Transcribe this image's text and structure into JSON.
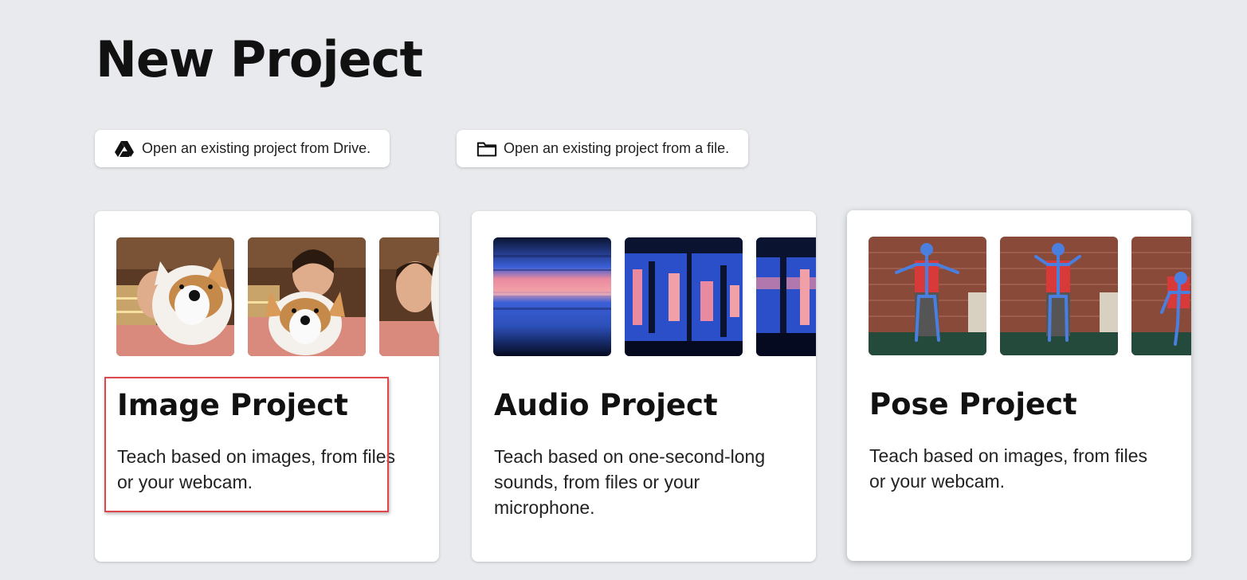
{
  "page": {
    "title": "New Project"
  },
  "open_buttons": {
    "drive": {
      "label": "Open an existing project from Drive.",
      "icon": "google-drive-icon"
    },
    "file": {
      "label": "Open an existing project from a file.",
      "icon": "folder-icon"
    }
  },
  "projects": [
    {
      "title": "Image Project",
      "description": "Teach based on images, from files or your webcam.",
      "thumbnails": [
        "webcam-photo-plush-corgi-1",
        "webcam-photo-plush-corgi-2",
        "webcam-photo-plush-corgi-3"
      ]
    },
    {
      "title": "Audio Project",
      "description": "Teach based on one-second-long sounds, from files or your microphone.",
      "thumbnails": [
        "spectrogram-1",
        "spectrogram-2",
        "spectrogram-3"
      ]
    },
    {
      "title": "Pose Project",
      "description": "Teach based on images, from files or your webcam.",
      "thumbnails": [
        "pose-skeleton-1",
        "pose-skeleton-2",
        "pose-skeleton-3"
      ]
    }
  ],
  "colors": {
    "background": "#e8eaed",
    "card": "#ffffff",
    "highlight_border": "#e0474c",
    "pose_skeleton": "#4a7fe0",
    "spectrogram_base": "#2c5bd6",
    "spectrogram_hot": "#e98aa0"
  }
}
